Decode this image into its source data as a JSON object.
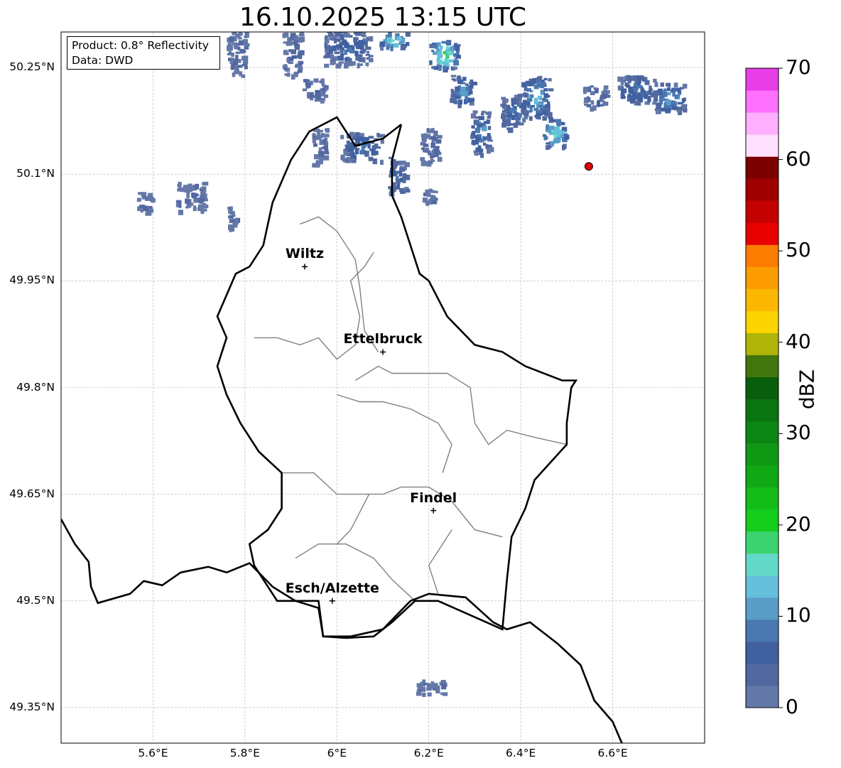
{
  "title": "16.10.2025 13:15 UTC",
  "info": {
    "product": "Product: 0.8° Reflectivity",
    "source": "Data: DWD"
  },
  "map_extent": {
    "lon": [
      5.4,
      6.8
    ],
    "lat": [
      49.3,
      50.3
    ]
  },
  "lat_ticks": [
    {
      "value": 50.25,
      "label": "50.25°N"
    },
    {
      "value": 50.1,
      "label": "50.1°N"
    },
    {
      "value": 49.95,
      "label": "49.95°N"
    },
    {
      "value": 49.8,
      "label": "49.8°N"
    },
    {
      "value": 49.65,
      "label": "49.65°N"
    },
    {
      "value": 49.5,
      "label": "49.5°N"
    },
    {
      "value": 49.35,
      "label": "49.35°N"
    }
  ],
  "lon_ticks": [
    {
      "value": 5.6,
      "label": "5.6°E"
    },
    {
      "value": 5.8,
      "label": "5.8°E"
    },
    {
      "value": 6.0,
      "label": "6°E"
    },
    {
      "value": 6.2,
      "label": "6.2°E"
    },
    {
      "value": 6.4,
      "label": "6.4°E"
    },
    {
      "value": 6.6,
      "label": "6.6°E"
    }
  ],
  "cities": [
    {
      "name": "Wiltz",
      "lon": 5.93,
      "lat": 49.97
    },
    {
      "name": "Ettelbruck",
      "lon": 6.1,
      "lat": 49.85
    },
    {
      "name": "Findel",
      "lon": 6.21,
      "lat": 49.627
    },
    {
      "name": "Esch/Alzette",
      "lon": 5.99,
      "lat": 49.5
    }
  ],
  "radar_site": {
    "lon": 6.548,
    "lat": 50.111
  },
  "colorbar": {
    "label": "dBZ",
    "min": 0,
    "max": 70,
    "ticks": [
      "0",
      "10",
      "20",
      "30",
      "40",
      "50",
      "60",
      "70"
    ],
    "colors": [
      "#6478a8",
      "#5268a0",
      "#4060a0",
      "#4a78b0",
      "#5a9ec8",
      "#66c0dc",
      "#64d8c8",
      "#3cd470",
      "#14cc1c",
      "#14bc18",
      "#10a814",
      "#109814",
      "#0c8614",
      "#0a7410",
      "#085e0c",
      "#40760c",
      "#b0b408",
      "#fcd400",
      "#fcb800",
      "#fc9c00",
      "#fc7c00",
      "#e80000",
      "#c40000",
      "#a00000",
      "#7c0000",
      "#fee0fe",
      "#feb0fe",
      "#fe70fe",
      "#e83ee8"
    ]
  },
  "precip_cells": [
    {
      "lon": 5.65,
      "lat": 50.28,
      "w": 0.12,
      "h": 0.02,
      "dbz": 3
    },
    {
      "lon": 5.78,
      "lat": 50.27,
      "w": 0.04,
      "h": 0.06,
      "dbz": 4
    },
    {
      "lon": 5.9,
      "lat": 50.27,
      "w": 0.04,
      "h": 0.06,
      "dbz": 5
    },
    {
      "lon": 5.95,
      "lat": 50.22,
      "w": 0.05,
      "h": 0.03,
      "dbz": 6
    },
    {
      "lon": 6.02,
      "lat": 50.28,
      "w": 0.1,
      "h": 0.05,
      "dbz": 8
    },
    {
      "lon": 6.12,
      "lat": 50.29,
      "w": 0.06,
      "h": 0.02,
      "dbz": 20
    },
    {
      "lon": 6.23,
      "lat": 50.27,
      "w": 0.06,
      "h": 0.04,
      "dbz": 22
    },
    {
      "lon": 6.27,
      "lat": 50.22,
      "w": 0.05,
      "h": 0.04,
      "dbz": 12
    },
    {
      "lon": 6.38,
      "lat": 50.19,
      "w": 0.05,
      "h": 0.05,
      "dbz": 9
    },
    {
      "lon": 6.43,
      "lat": 50.21,
      "w": 0.06,
      "h": 0.06,
      "dbz": 14
    },
    {
      "lon": 6.47,
      "lat": 50.16,
      "w": 0.05,
      "h": 0.04,
      "dbz": 18
    },
    {
      "lon": 6.56,
      "lat": 50.21,
      "w": 0.05,
      "h": 0.03,
      "dbz": 6
    },
    {
      "lon": 6.65,
      "lat": 50.22,
      "w": 0.08,
      "h": 0.04,
      "dbz": 10
    },
    {
      "lon": 6.72,
      "lat": 50.21,
      "w": 0.07,
      "h": 0.04,
      "dbz": 13
    },
    {
      "lon": 6.31,
      "lat": 50.16,
      "w": 0.04,
      "h": 0.06,
      "dbz": 11
    },
    {
      "lon": 6.05,
      "lat": 50.14,
      "w": 0.09,
      "h": 0.04,
      "dbz": 9
    },
    {
      "lon": 5.96,
      "lat": 50.14,
      "w": 0.03,
      "h": 0.05,
      "dbz": 4
    },
    {
      "lon": 6.13,
      "lat": 50.1,
      "w": 0.04,
      "h": 0.05,
      "dbz": 7
    },
    {
      "lon": 6.2,
      "lat": 50.14,
      "w": 0.04,
      "h": 0.05,
      "dbz": 5
    },
    {
      "lon": 6.2,
      "lat": 50.07,
      "w": 0.03,
      "h": 0.02,
      "dbz": 3
    },
    {
      "lon": 5.58,
      "lat": 50.06,
      "w": 0.03,
      "h": 0.03,
      "dbz": 2
    },
    {
      "lon": 5.68,
      "lat": 50.07,
      "w": 0.06,
      "h": 0.04,
      "dbz": 3
    },
    {
      "lon": 5.77,
      "lat": 50.04,
      "w": 0.02,
      "h": 0.03,
      "dbz": 2
    },
    {
      "lon": 6.2,
      "lat": 49.38,
      "w": 0.06,
      "h": 0.02,
      "dbz": 3
    }
  ],
  "country_border": [
    [
      5.4,
      49.615
    ],
    [
      5.43,
      49.58
    ],
    [
      5.46,
      49.555
    ],
    [
      5.465,
      49.52
    ],
    [
      5.48,
      49.497
    ],
    [
      5.55,
      49.51
    ],
    [
      5.58,
      49.528
    ],
    [
      5.62,
      49.522
    ],
    [
      5.66,
      49.54
    ],
    [
      5.72,
      49.548
    ],
    [
      5.76,
      49.54
    ],
    [
      5.81,
      49.553
    ],
    [
      5.86,
      49.52
    ],
    [
      5.91,
      49.5
    ],
    [
      5.96,
      49.5
    ],
    [
      5.97,
      49.45
    ],
    [
      6.03,
      49.45
    ],
    [
      6.1,
      49.46
    ],
    [
      6.16,
      49.5
    ],
    [
      6.2,
      49.51
    ],
    [
      6.28,
      49.505
    ],
    [
      6.34,
      49.47
    ],
    [
      6.37,
      49.46
    ],
    [
      6.42,
      49.47
    ],
    [
      6.48,
      49.44
    ],
    [
      6.53,
      49.41
    ],
    [
      6.56,
      49.36
    ],
    [
      6.6,
      49.33
    ],
    [
      6.62,
      49.3
    ]
  ],
  "lux_border": [
    [
      6.14,
      50.17
    ],
    [
      6.12,
      50.12
    ],
    [
      6.12,
      50.07
    ],
    [
      6.14,
      50.04
    ],
    [
      6.18,
      49.96
    ],
    [
      6.2,
      49.95
    ],
    [
      6.24,
      49.9
    ],
    [
      6.3,
      49.86
    ],
    [
      6.36,
      49.85
    ],
    [
      6.41,
      49.83
    ],
    [
      6.49,
      49.81
    ],
    [
      6.52,
      49.81
    ],
    [
      6.51,
      49.8
    ],
    [
      6.5,
      49.75
    ],
    [
      6.5,
      49.72
    ],
    [
      6.43,
      49.67
    ],
    [
      6.41,
      49.63
    ],
    [
      6.38,
      49.59
    ],
    [
      6.37,
      49.53
    ],
    [
      6.36,
      49.46
    ],
    [
      6.29,
      49.48
    ],
    [
      6.22,
      49.5
    ],
    [
      6.17,
      49.5
    ],
    [
      6.12,
      49.47
    ],
    [
      6.08,
      49.45
    ],
    [
      6.02,
      49.448
    ],
    [
      5.97,
      49.45
    ],
    [
      5.96,
      49.49
    ],
    [
      5.91,
      49.5
    ],
    [
      5.87,
      49.5
    ],
    [
      5.84,
      49.53
    ],
    [
      5.82,
      49.55
    ],
    [
      5.81,
      49.58
    ],
    [
      5.85,
      49.6
    ],
    [
      5.88,
      49.63
    ],
    [
      5.88,
      49.68
    ],
    [
      5.83,
      49.71
    ],
    [
      5.79,
      49.75
    ],
    [
      5.76,
      49.79
    ],
    [
      5.74,
      49.83
    ],
    [
      5.76,
      49.87
    ],
    [
      5.74,
      49.9
    ],
    [
      5.78,
      49.96
    ],
    [
      5.81,
      49.97
    ],
    [
      5.84,
      50.0
    ],
    [
      5.86,
      50.06
    ],
    [
      5.9,
      50.12
    ],
    [
      5.94,
      50.16
    ],
    [
      6.0,
      50.18
    ],
    [
      6.04,
      50.14
    ],
    [
      6.1,
      50.15
    ],
    [
      6.14,
      50.17
    ]
  ],
  "canton_lines": [
    [
      [
        5.82,
        49.87
      ],
      [
        5.87,
        49.87
      ],
      [
        5.92,
        49.86
      ],
      [
        5.96,
        49.87
      ],
      [
        6.0,
        49.84
      ],
      [
        6.04,
        49.86
      ],
      [
        6.05,
        49.9
      ],
      [
        6.03,
        49.95
      ],
      [
        6.06,
        49.97
      ],
      [
        6.08,
        49.99
      ]
    ],
    [
      [
        5.92,
        50.03
      ],
      [
        5.96,
        50.04
      ],
      [
        6.0,
        50.02
      ],
      [
        6.04,
        49.98
      ],
      [
        6.05,
        49.94
      ],
      [
        6.06,
        49.88
      ],
      [
        6.09,
        49.85
      ]
    ],
    [
      [
        6.04,
        49.81
      ],
      [
        6.09,
        49.83
      ],
      [
        6.12,
        49.82
      ],
      [
        6.18,
        49.82
      ],
      [
        6.24,
        49.82
      ],
      [
        6.29,
        49.8
      ],
      [
        6.3,
        49.75
      ],
      [
        6.33,
        49.72
      ],
      [
        6.37,
        49.74
      ],
      [
        6.43,
        49.73
      ],
      [
        6.5,
        49.72
      ]
    ],
    [
      [
        5.88,
        49.68
      ],
      [
        5.95,
        49.68
      ],
      [
        6.0,
        49.65
      ],
      [
        6.06,
        49.65
      ],
      [
        6.1,
        49.65
      ],
      [
        6.14,
        49.66
      ],
      [
        6.2,
        49.66
      ],
      [
        6.25,
        49.64
      ],
      [
        6.3,
        49.6
      ],
      [
        6.36,
        49.59
      ]
    ],
    [
      [
        6.0,
        49.79
      ],
      [
        6.05,
        49.78
      ],
      [
        6.1,
        49.78
      ],
      [
        6.16,
        49.77
      ],
      [
        6.22,
        49.75
      ],
      [
        6.25,
        49.72
      ],
      [
        6.23,
        49.68
      ]
    ],
    [
      [
        5.91,
        49.56
      ],
      [
        5.96,
        49.58
      ],
      [
        6.02,
        49.58
      ],
      [
        6.08,
        49.56
      ],
      [
        6.12,
        49.53
      ],
      [
        6.17,
        49.5
      ]
    ],
    [
      [
        6.07,
        49.65
      ],
      [
        6.03,
        49.6
      ],
      [
        6.0,
        49.58
      ]
    ],
    [
      [
        6.25,
        49.6
      ],
      [
        6.2,
        49.55
      ],
      [
        6.22,
        49.51
      ]
    ]
  ]
}
